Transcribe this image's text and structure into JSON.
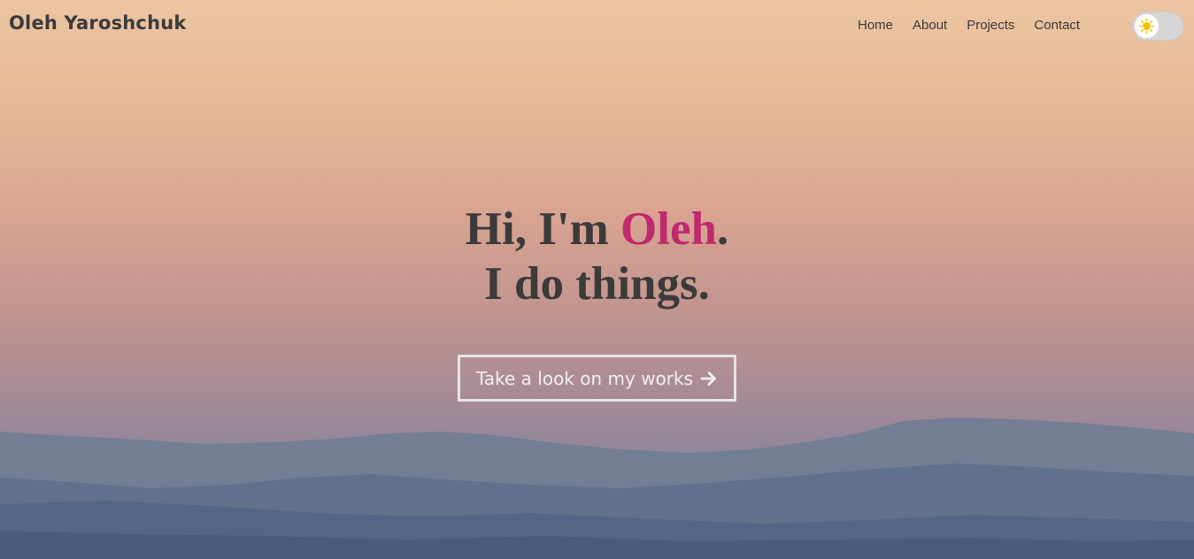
{
  "brand": {
    "name": "Oleh Yaroshchuk"
  },
  "nav": {
    "items": [
      {
        "label": "Home"
      },
      {
        "label": "About"
      },
      {
        "label": "Projects"
      },
      {
        "label": "Contact"
      }
    ]
  },
  "theme_toggle": {
    "icon": "sun-icon",
    "state": "light"
  },
  "hero": {
    "greeting_prefix": "Hi, I'm ",
    "greeting_name": "Oleh",
    "greeting_suffix": ".",
    "tagline": "I do things.",
    "cta_label": "Take a look on my works",
    "cta_icon": "arrow-right-icon"
  },
  "colors": {
    "accent": "#c0296e",
    "text_dark": "#3b3b3b",
    "cta_border": "#e6e6e6",
    "sun": "#f2c200"
  }
}
